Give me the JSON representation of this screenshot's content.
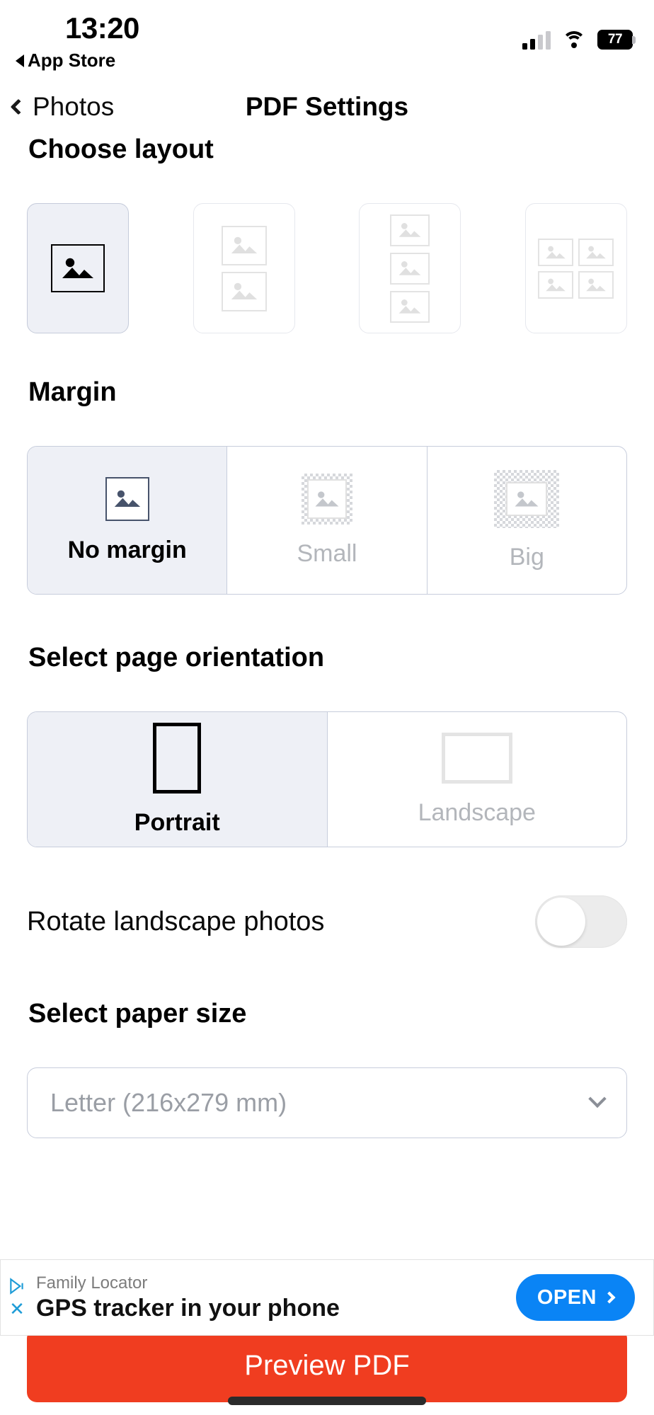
{
  "status_bar": {
    "time": "13:20",
    "back_app_label": "App Store",
    "back_app_icon": "triangle-left-icon",
    "signal_icon": "cellular-signal-icon",
    "wifi_icon": "wifi-icon",
    "battery_percent": "77"
  },
  "nav": {
    "back_label": "Photos",
    "back_icon": "chevron-left-icon",
    "title": "PDF Settings"
  },
  "layout_section": {
    "title": "Choose layout",
    "options": [
      {
        "name": "one-photo",
        "photos": 1,
        "selected": true
      },
      {
        "name": "two-photos",
        "photos": 2,
        "selected": false
      },
      {
        "name": "three-photos",
        "photos": 3,
        "selected": false
      },
      {
        "name": "four-photos",
        "photos": 4,
        "selected": false
      }
    ]
  },
  "margin_section": {
    "title": "Margin",
    "options": [
      {
        "label": "No margin",
        "selected": true
      },
      {
        "label": "Small",
        "selected": false
      },
      {
        "label": "Big",
        "selected": false
      }
    ]
  },
  "orientation_section": {
    "title": "Select page orientation",
    "options": [
      {
        "label": "Portrait",
        "selected": true
      },
      {
        "label": "Landscape",
        "selected": false
      }
    ]
  },
  "rotate_row": {
    "label": "Rotate landscape photos",
    "toggle_state": "off"
  },
  "paper_section": {
    "title": "Select paper size",
    "selected_value": "Letter (216x279 mm)",
    "chevron_icon": "chevron-down-icon"
  },
  "primary_action": {
    "label": "Preview PDF",
    "color": "#f03d20"
  },
  "ad": {
    "advertiser": "Family Locator",
    "headline": "GPS tracker in your phone",
    "cta_label": "OPEN",
    "cta_color": "#0a84f5",
    "adchoices_icon": "adchoices-icon",
    "close_icon": "close-icon"
  },
  "colors": {
    "selected_fill": "#eef0f6",
    "selected_border": "#c5cbda",
    "segment_border": "#c7cddc"
  }
}
